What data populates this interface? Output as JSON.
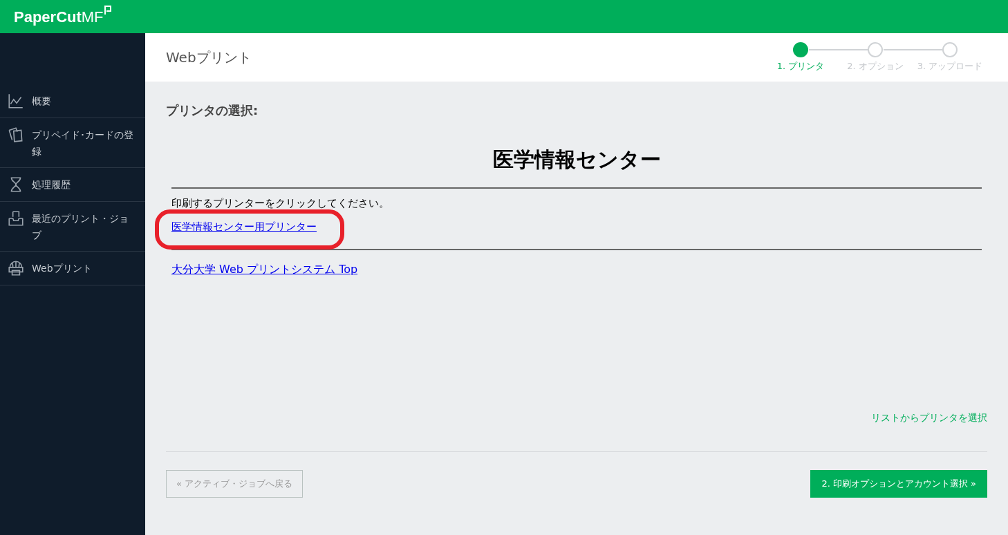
{
  "brand": {
    "name": "PaperCut",
    "suffix": "MF"
  },
  "sidebar": {
    "items": [
      {
        "kind": "chart",
        "label": "概要"
      },
      {
        "kind": "cards",
        "label": "プリペイド･カードの登録"
      },
      {
        "kind": "hourglass",
        "label": "処理履歴"
      },
      {
        "kind": "tray",
        "label": "最近のプリント・ジョブ"
      },
      {
        "kind": "globe-printer",
        "label": "Webプリント"
      }
    ]
  },
  "page": {
    "title": "Webプリント",
    "steps": [
      {
        "label": "1. プリンタ",
        "selected": true
      },
      {
        "label": "2. オプション",
        "selected": false
      },
      {
        "label": "3. アップロード",
        "selected": false
      }
    ]
  },
  "content": {
    "heading": "プリンタの選択:",
    "site_title": "医学情報センター",
    "instruction": "印刷するプリンターをクリックしてください。",
    "printer_links": [
      {
        "label": "医学情報センター用プリンター",
        "highlighted": true
      }
    ],
    "top_link": "大分大学 Web プリントシステム Top",
    "list_link": "リストからプリンタを選択",
    "back_button": "« アクティブ・ジョブへ戻る",
    "next_button": "2. 印刷オプションとアカウント選択 »"
  }
}
